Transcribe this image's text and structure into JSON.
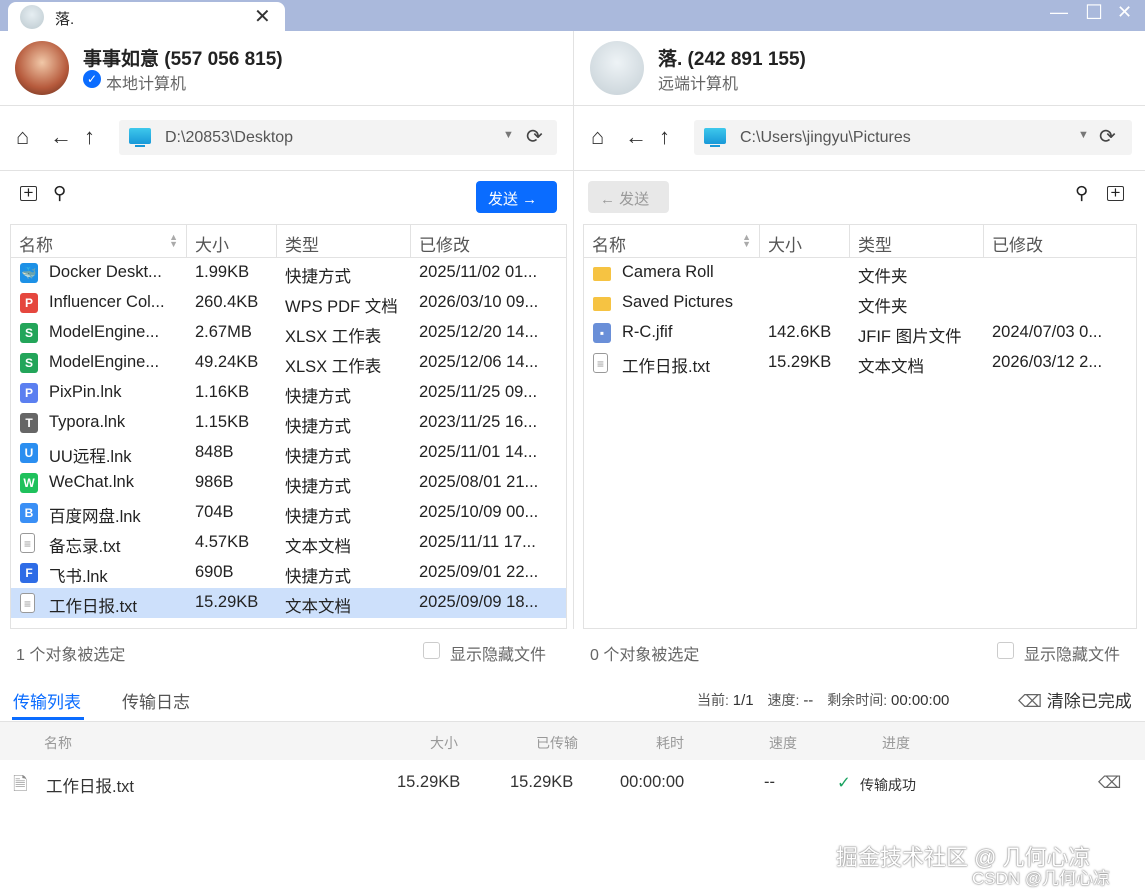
{
  "window": {
    "tab_title": "落.",
    "close": "✕",
    "minimize": "—",
    "maximize": "☐",
    "close_window": "✕"
  },
  "local": {
    "name": "事事如意 (557 056 815)",
    "subtitle": "本地计算机",
    "path": "D:\\20853\\Desktop",
    "send_label": "发送 →",
    "columns": [
      "名称",
      "大小",
      "类型",
      "已修改"
    ],
    "rows": [
      {
        "name": "Docker Deskt...",
        "size": "1.99KB",
        "type": "快捷方式",
        "modified": "2025/11/02 01...",
        "icon": "docker-icon",
        "color": "#1d91e6",
        "glyph": "🐳"
      },
      {
        "name": "Influencer Col...",
        "size": "260.4KB",
        "type": "WPS PDF 文档",
        "modified": "2026/03/10 09...",
        "icon": "pdf-icon",
        "color": "#e5473e",
        "glyph": "P"
      },
      {
        "name": "ModelEngine...",
        "size": "2.67MB",
        "type": "XLSX 工作表",
        "modified": "2025/12/20 14...",
        "icon": "xlsx-icon",
        "color": "#23a55a",
        "glyph": "S"
      },
      {
        "name": "ModelEngine...",
        "size": "49.24KB",
        "type": "XLSX 工作表",
        "modified": "2025/12/06 14...",
        "icon": "xlsx-icon",
        "color": "#23a55a",
        "glyph": "S"
      },
      {
        "name": "PixPin.lnk",
        "size": "1.16KB",
        "type": "快捷方式",
        "modified": "2025/11/25 09...",
        "icon": "pixpin-icon",
        "color": "#5b7ff0",
        "glyph": "P"
      },
      {
        "name": "Typora.lnk",
        "size": "1.15KB",
        "type": "快捷方式",
        "modified": "2023/11/25 16...",
        "icon": "typora-icon",
        "color": "#666",
        "glyph": "T"
      },
      {
        "name": "UU远程.lnk",
        "size": "848B",
        "type": "快捷方式",
        "modified": "2025/11/01 14...",
        "icon": "uu-remote-icon",
        "color": "#2b8ef0",
        "glyph": "U"
      },
      {
        "name": "WeChat.lnk",
        "size": "986B",
        "type": "快捷方式",
        "modified": "2025/08/01 21...",
        "icon": "wechat-icon",
        "color": "#1fc15c",
        "glyph": "W"
      },
      {
        "name": "百度网盘.lnk",
        "size": "704B",
        "type": "快捷方式",
        "modified": "2025/10/09 00...",
        "icon": "baidu-netdisk-icon",
        "color": "#3a8ff5",
        "glyph": "B"
      },
      {
        "name": "备忘录.txt",
        "size": "4.57KB",
        "type": "文本文档",
        "modified": "2025/11/11 17...",
        "icon": "text-file-icon",
        "color": "#999",
        "glyph": "≡"
      },
      {
        "name": "飞书.lnk",
        "size": "690B",
        "type": "快捷方式",
        "modified": "2025/09/01 22...",
        "icon": "feishu-icon",
        "color": "#2e6ce6",
        "glyph": "F"
      },
      {
        "name": "工作日报.txt",
        "size": "15.29KB",
        "type": "文本文档",
        "modified": "2025/09/09 18...",
        "icon": "text-file-icon",
        "color": "#999",
        "glyph": "≡",
        "selected": true
      }
    ],
    "status": "1 个对象被选定",
    "show_hidden": "显示隐藏文件"
  },
  "remote": {
    "name": "落. (242 891 155)",
    "subtitle": "远端计算机",
    "path": "C:\\Users\\jingyu\\Pictures",
    "send_label": "← 发送",
    "columns": [
      "名称",
      "大小",
      "类型",
      "已修改"
    ],
    "rows": [
      {
        "name": "Camera Roll",
        "size": "",
        "type": "文件夹",
        "modified": "",
        "icon": "folder-icon",
        "color": "#f6c342",
        "glyph": ""
      },
      {
        "name": "Saved Pictures",
        "size": "",
        "type": "文件夹",
        "modified": "",
        "icon": "folder-icon",
        "color": "#f6c342",
        "glyph": ""
      },
      {
        "name": "R-C.jfif",
        "size": "142.6KB",
        "type": "JFIF 图片文件",
        "modified": "2024/07/03 0...",
        "icon": "image-file-icon",
        "color": "#6a8fd8",
        "glyph": "▪"
      },
      {
        "name": "工作日报.txt",
        "size": "15.29KB",
        "type": "文本文档",
        "modified": "2026/03/12 2...",
        "icon": "text-file-icon",
        "color": "#999",
        "glyph": "≡"
      }
    ],
    "status": "0 个对象被选定",
    "show_hidden": "显示隐藏文件"
  },
  "transfer": {
    "tabs": [
      "传输列表",
      "传输日志"
    ],
    "current_label": "当前:",
    "current": "1/1",
    "speed_label": "速度:",
    "speed": "--",
    "remaining_label": "剩余时间:",
    "remaining": "00:00:00",
    "clear_label": "清除已完成",
    "columns": [
      "名称",
      "大小",
      "已传输",
      "耗时",
      "速度",
      "进度"
    ],
    "rows": [
      {
        "name": "工作日报.txt",
        "size": "15.29KB",
        "transferred": "15.29KB",
        "elapsed": "00:00:00",
        "speed": "--",
        "progress": "传输成功"
      }
    ]
  },
  "watermark": {
    "line1": "掘金技术社区 @ 几何心凉",
    "line2": "CSDN @几何心凉"
  },
  "colors": {
    "accent": "#0a6cff",
    "success": "#1aa260"
  }
}
